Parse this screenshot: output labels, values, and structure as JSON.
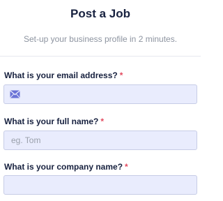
{
  "header": {
    "title": "Post a Job",
    "subtitle": "Set-up your business profile in 2 minutes."
  },
  "form": {
    "required_marker": "*",
    "email": {
      "label": "What is your email address?",
      "value": "",
      "placeholder": "",
      "icon": "mail-icon"
    },
    "full_name": {
      "label": "What is your full name?",
      "value": "",
      "placeholder": "eg. Tom"
    },
    "company": {
      "label": "What is your company name?",
      "value": "",
      "placeholder": ""
    }
  },
  "colors": {
    "title": "#17213f",
    "subtitle": "#8d94a0",
    "required": "#e34a5f",
    "field_background": "#e9ecfd",
    "field_border": "#c7cce6",
    "icon": "#6b73d6"
  }
}
